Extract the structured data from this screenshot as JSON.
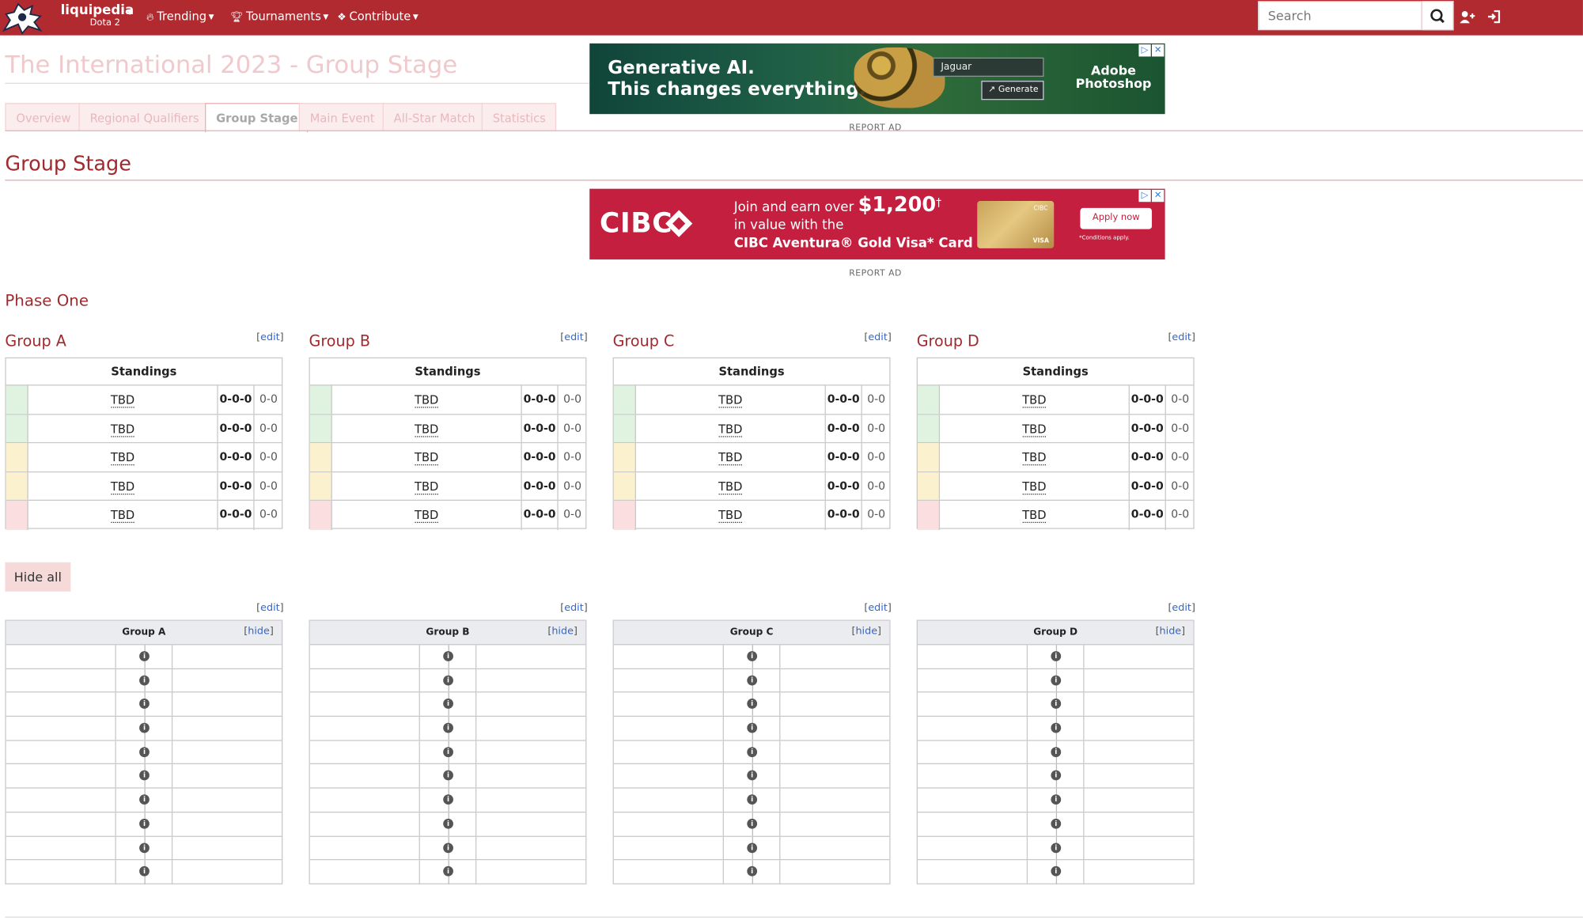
{
  "nav": {
    "brand": "liquipedia",
    "brand_sub": "Dota 2",
    "items": [
      {
        "label": "Trending",
        "icon": "fire-icon"
      },
      {
        "label": "Tournaments",
        "icon": "trophy-icon"
      },
      {
        "label": "Contribute",
        "icon": "puzzle-icon"
      }
    ],
    "search_placeholder": "Search",
    "accent": "#b02a30"
  },
  "page": {
    "title": "The International 2023 - Group Stage",
    "tabs": [
      "Overview",
      "Regional Qualifiers",
      "Group Stage",
      "Main Event",
      "All-Star Match",
      "Statistics"
    ],
    "active_tab": "Group Stage",
    "section_title": "Group Stage",
    "subsection_title": "Phase One"
  },
  "ads": {
    "report_label": "REPORT AD",
    "ad1": {
      "headline1": "Generative AI.",
      "headline2": "This changes everything.",
      "field_value": "Jaguar",
      "button": "Generate",
      "brand_line1": "Adobe",
      "brand_line2": "Photoshop"
    },
    "ad2": {
      "logo": "CIBC",
      "line1_pre": "Join and earn over ",
      "line1_amount": "$1,200",
      "line1_sup": "†",
      "line2": "in value with the",
      "line3": "CIBC Aventura® Gold Visa* Card",
      "button": "Apply now",
      "conditions": "*Conditions apply.",
      "card_brand": "CIBC",
      "card_network": "VISA"
    }
  },
  "edit_label": "edit",
  "hide_label": "hide",
  "hide_all": "Hide all",
  "standings_header": "Standings",
  "groups": [
    {
      "name": "Group A",
      "rows": [
        {
          "team": "TBD",
          "record": "0-0-0",
          "games": "0-0",
          "status": "green"
        },
        {
          "team": "TBD",
          "record": "0-0-0",
          "games": "0-0",
          "status": "green"
        },
        {
          "team": "TBD",
          "record": "0-0-0",
          "games": "0-0",
          "status": "yellow"
        },
        {
          "team": "TBD",
          "record": "0-0-0",
          "games": "0-0",
          "status": "yellow"
        },
        {
          "team": "TBD",
          "record": "0-0-0",
          "games": "0-0",
          "status": "red"
        }
      ]
    },
    {
      "name": "Group B",
      "rows": [
        {
          "team": "TBD",
          "record": "0-0-0",
          "games": "0-0",
          "status": "green"
        },
        {
          "team": "TBD",
          "record": "0-0-0",
          "games": "0-0",
          "status": "green"
        },
        {
          "team": "TBD",
          "record": "0-0-0",
          "games": "0-0",
          "status": "yellow"
        },
        {
          "team": "TBD",
          "record": "0-0-0",
          "games": "0-0",
          "status": "yellow"
        },
        {
          "team": "TBD",
          "record": "0-0-0",
          "games": "0-0",
          "status": "red"
        }
      ]
    },
    {
      "name": "Group C",
      "rows": [
        {
          "team": "TBD",
          "record": "0-0-0",
          "games": "0-0",
          "status": "green"
        },
        {
          "team": "TBD",
          "record": "0-0-0",
          "games": "0-0",
          "status": "green"
        },
        {
          "team": "TBD",
          "record": "0-0-0",
          "games": "0-0",
          "status": "yellow"
        },
        {
          "team": "TBD",
          "record": "0-0-0",
          "games": "0-0",
          "status": "yellow"
        },
        {
          "team": "TBD",
          "record": "0-0-0",
          "games": "0-0",
          "status": "red"
        }
      ]
    },
    {
      "name": "Group D",
      "rows": [
        {
          "team": "TBD",
          "record": "0-0-0",
          "games": "0-0",
          "status": "green"
        },
        {
          "team": "TBD",
          "record": "0-0-0",
          "games": "0-0",
          "status": "green"
        },
        {
          "team": "TBD",
          "record": "0-0-0",
          "games": "0-0",
          "status": "yellow"
        },
        {
          "team": "TBD",
          "record": "0-0-0",
          "games": "0-0",
          "status": "yellow"
        },
        {
          "team": "TBD",
          "record": "0-0-0",
          "games": "0-0",
          "status": "red"
        }
      ]
    }
  ],
  "match_rows_per_group": 10,
  "status_colors": {
    "green": "#dff3e0",
    "yellow": "#fbf1cf",
    "red": "#fbdfe0"
  }
}
